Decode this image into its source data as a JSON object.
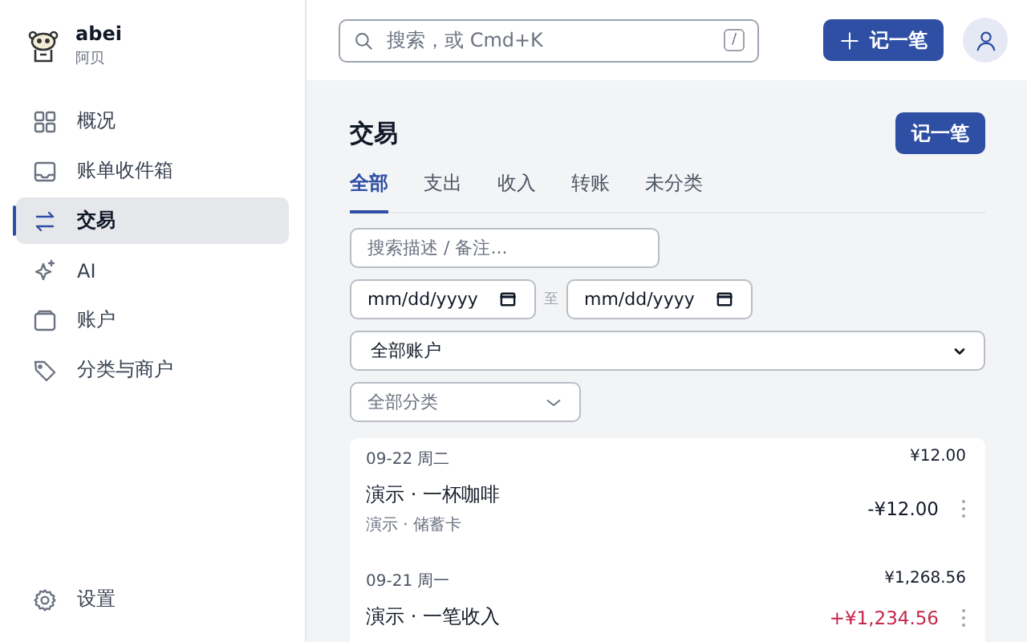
{
  "brand": {
    "name": "abei",
    "subtitle": "阿贝"
  },
  "sidebar": {
    "items": [
      {
        "label": "概况",
        "selected": false
      },
      {
        "label": "账单收件箱",
        "selected": false
      },
      {
        "label": "交易",
        "selected": true
      },
      {
        "label": "AI",
        "selected": false
      },
      {
        "label": "账户",
        "selected": false
      },
      {
        "label": "分类与商户",
        "selected": false
      }
    ],
    "footer": {
      "label": "设置"
    }
  },
  "topbar": {
    "search": {
      "placeholder": "搜索，或 Cmd+K",
      "shortcut": "/"
    },
    "add_button": "记一笔"
  },
  "page": {
    "title": "交易",
    "add_button": "记一笔",
    "tabs": [
      {
        "label": "全部",
        "selected": true
      },
      {
        "label": "支出",
        "selected": false
      },
      {
        "label": "收入",
        "selected": false
      },
      {
        "label": "转账",
        "selected": false
      },
      {
        "label": "未分类",
        "selected": false
      }
    ],
    "filters": {
      "search": {
        "placeholder": "搜索描述 / 备注..."
      },
      "date_from": {
        "placeholder": "mm/dd/yyyy"
      },
      "date_separator": "至",
      "date_to": {
        "placeholder": "mm/dd/yyyy"
      },
      "account": {
        "value": "全部账户"
      },
      "category": {
        "placeholder": "全部分类"
      }
    },
    "days": [
      {
        "date": "09-22 周二",
        "total": "¥12.00",
        "transactions": [
          {
            "title": "演示 · 一杯咖啡",
            "subtitle": "演示 · 储蓄卡",
            "amount": "-¥12.00",
            "kind": "expense"
          }
        ]
      },
      {
        "date": "09-21 周一",
        "total": "¥1,268.56",
        "transactions": [
          {
            "title": "演示 · 一笔收入",
            "amount": "+¥1,234.56",
            "kind": "income"
          }
        ]
      }
    ]
  }
}
